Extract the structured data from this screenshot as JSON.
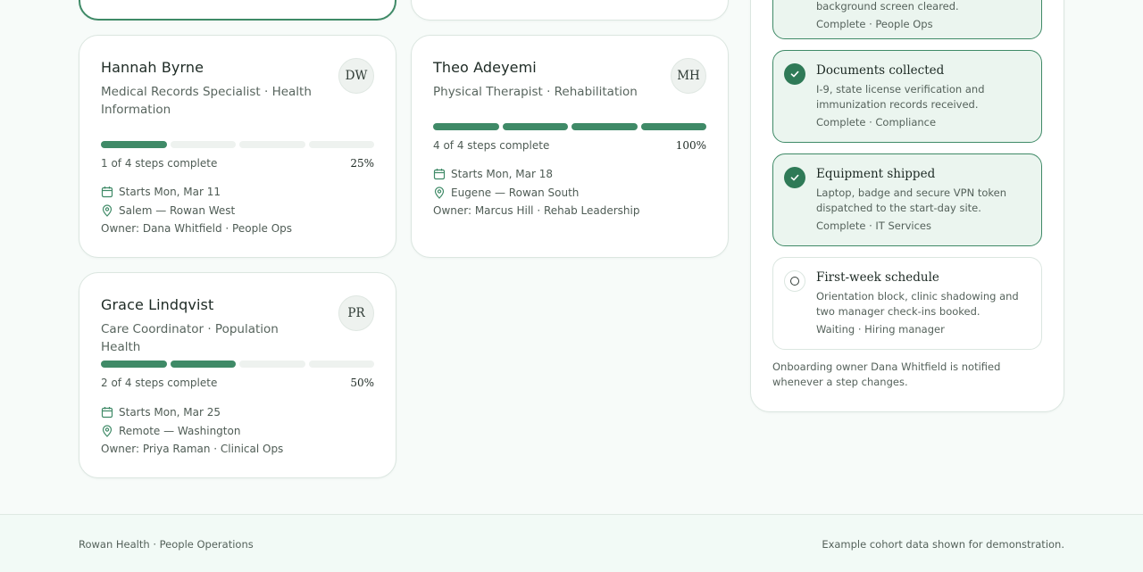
{
  "colors": {
    "accent": "#3f8a67",
    "check": "#2f7a57",
    "track": "#eef2ef",
    "step_complete_bg": "#ebf5ef"
  },
  "people": [
    {
      "name": "Hannah Byrne",
      "role": "Medical Records Specialist · Health Information",
      "initials": "DW",
      "steps_done": 1,
      "steps_total": 4,
      "steps_text": "1 of 4 steps complete",
      "percent": "25%",
      "start": "Starts Mon, Mar 11",
      "location": "Salem — Rowan West",
      "owner": "Owner: Dana Whitfield · People Ops"
    },
    {
      "name": "Theo Adeyemi",
      "role": "Physical Therapist · Rehabilitation",
      "initials": "MH",
      "steps_done": 4,
      "steps_total": 4,
      "steps_text": "4 of 4 steps complete",
      "percent": "100%",
      "start": "Starts Mon, Mar 18",
      "location": "Eugene — Rowan South",
      "owner": "Owner: Marcus Hill · Rehab Leadership"
    },
    {
      "name": "Grace Lindqvist",
      "role": "Care Coordinator · Population Health",
      "initials": "PR",
      "steps_done": 2,
      "steps_total": 4,
      "steps_text": "2 of 4 steps complete",
      "percent": "50%",
      "start": "Starts Mon, Mar 25",
      "location": "Remote — Washington",
      "owner": "Owner: Priya Raman · Clinical Ops"
    }
  ],
  "panel": {
    "steps": [
      {
        "title": "",
        "description": "background screen cleared.",
        "status": "Complete · People Ops",
        "state": "complete"
      },
      {
        "title": "Documents collected",
        "description": "I-9, state license verification and immunization records received.",
        "status": "Complete · Compliance",
        "state": "complete"
      },
      {
        "title": "Equipment shipped",
        "description": "Laptop, badge and secure VPN token dispatched to the start-day site.",
        "status": "Complete · IT Services",
        "state": "complete"
      },
      {
        "title": "First-week schedule",
        "description": "Orientation block, clinic shadowing and two manager check-ins booked.",
        "status": "Waiting · Hiring manager",
        "state": "waiting"
      }
    ],
    "note": "Onboarding owner Dana Whitfield is notified whenever a step changes."
  },
  "icons": {
    "calendar": "calendar-icon",
    "location": "location-pin-icon",
    "check": "check-icon",
    "open": "open-circle-icon"
  },
  "footer": {
    "left": "Rowan Health · People Operations",
    "right": "Example cohort data shown for demonstration."
  }
}
